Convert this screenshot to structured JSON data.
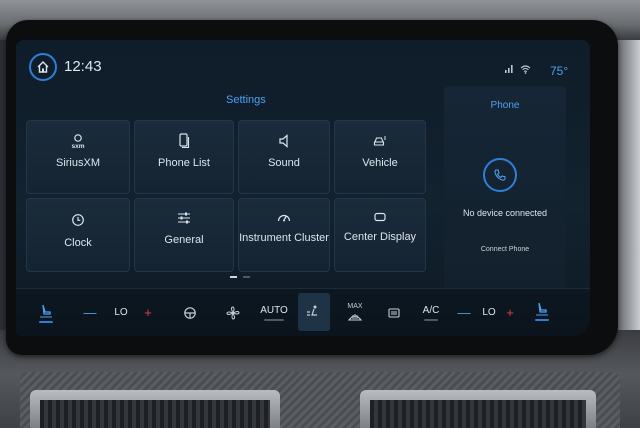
{
  "status_bar": {
    "time": "12:43",
    "temperature": "75°"
  },
  "settings": {
    "title": "Settings",
    "tiles": [
      {
        "label": "SiriusXM",
        "icon": "siriusxm-icon"
      },
      {
        "label": "Phone List",
        "icon": "phone-list-icon"
      },
      {
        "label": "Sound",
        "icon": "speaker-icon"
      },
      {
        "label": "Vehicle",
        "icon": "vehicle-icon"
      },
      {
        "label": "Clock",
        "icon": "clock-icon"
      },
      {
        "label": "General",
        "icon": "sliders-icon"
      },
      {
        "label": "Instrument Cluster",
        "icon": "gauge-icon"
      },
      {
        "label": "Center Display",
        "icon": "display-icon"
      }
    ],
    "siriusxm_logo_text": "sxm"
  },
  "phone": {
    "title": "Phone",
    "status": "No device connected",
    "connect_label": "Connect Phone"
  },
  "climate": {
    "left_temp": "LO",
    "right_temp": "LO",
    "auto_label": "AUTO",
    "max_label": "MAX",
    "ac_label": "A/C",
    "minus": "—",
    "plus": "+"
  },
  "colors": {
    "accent": "#2f7fd9",
    "heat": "#e0403a",
    "text": "#dbe5ee"
  }
}
